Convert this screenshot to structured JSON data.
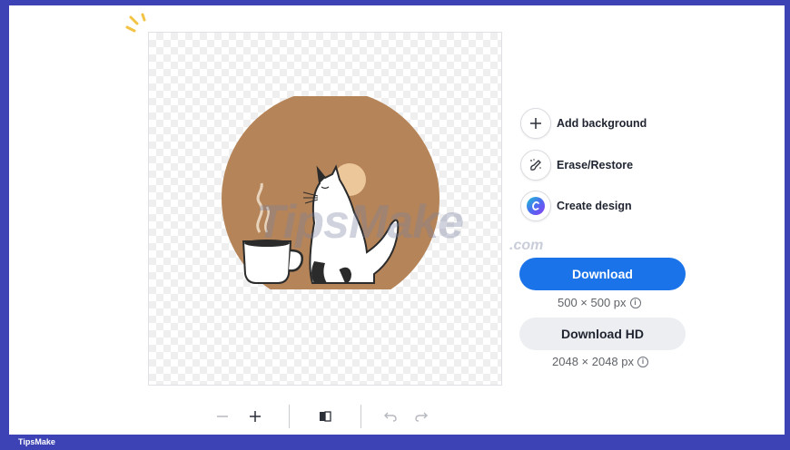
{
  "actions": {
    "add_background": {
      "label": "Add background",
      "icon": "plus-icon"
    },
    "erase_restore": {
      "label": "Erase/Restore",
      "icon": "magic-brush-icon"
    },
    "create_design": {
      "label": "Create design",
      "icon": "canva-logo-icon"
    }
  },
  "download": {
    "label": "Download",
    "size": "500 × 500 px"
  },
  "download_hd": {
    "label": "Download HD",
    "size": "2048 × 2048 px"
  },
  "toolbar": {
    "zoom_out_icon": "minus-icon",
    "zoom_in_icon": "plus-icon",
    "compare_icon": "compare-icon",
    "undo_icon": "undo-icon",
    "redo_icon": "redo-icon"
  },
  "watermark": {
    "main": "TipsMake",
    "suffix": ".com"
  },
  "brand": "TipsMake",
  "colors": {
    "primary": "#1a73e8",
    "frame": "#3d43b4",
    "art_brown": "#b58458"
  }
}
